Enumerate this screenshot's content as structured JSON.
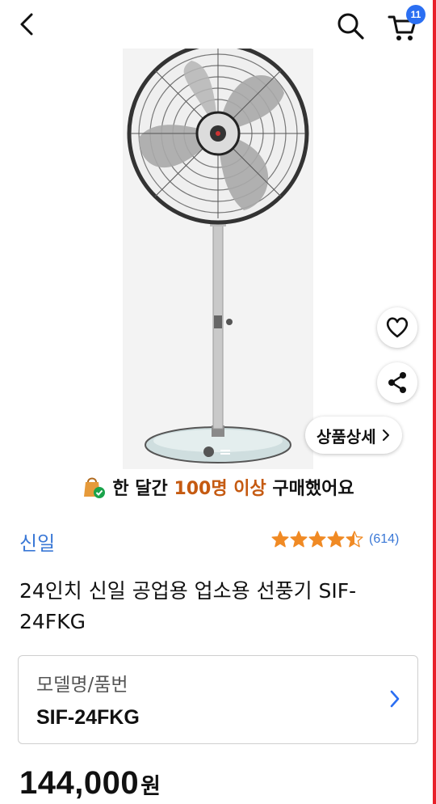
{
  "header": {
    "back_icon": "chevron-left-icon",
    "search_icon": "search-icon",
    "cart_icon": "cart-icon",
    "cart_count": "11",
    "badge_color": "#2b6ff2"
  },
  "product": {
    "image_dots": {
      "current": 1,
      "total": 2
    },
    "wish_icon": "heart-icon",
    "share_icon": "share-icon",
    "detail_label": "상품상세",
    "purchase_prefix": "한 달간",
    "purchase_highlight": "100명 이상",
    "purchase_suffix": "구매했어요",
    "brand": "신일",
    "rating": 4.5,
    "review_count": "(614)",
    "title": "24인치 신일 공업용 업소용 선풍기 SIF-24FKG",
    "option_label": "모델명/품번",
    "option_value": "SIF-24FKG",
    "price": "144,000",
    "price_unit": "원"
  },
  "colors": {
    "link": "#3a78d6",
    "highlight": "#c55a11",
    "star": "#f08a24",
    "edge": "#e8202a"
  }
}
